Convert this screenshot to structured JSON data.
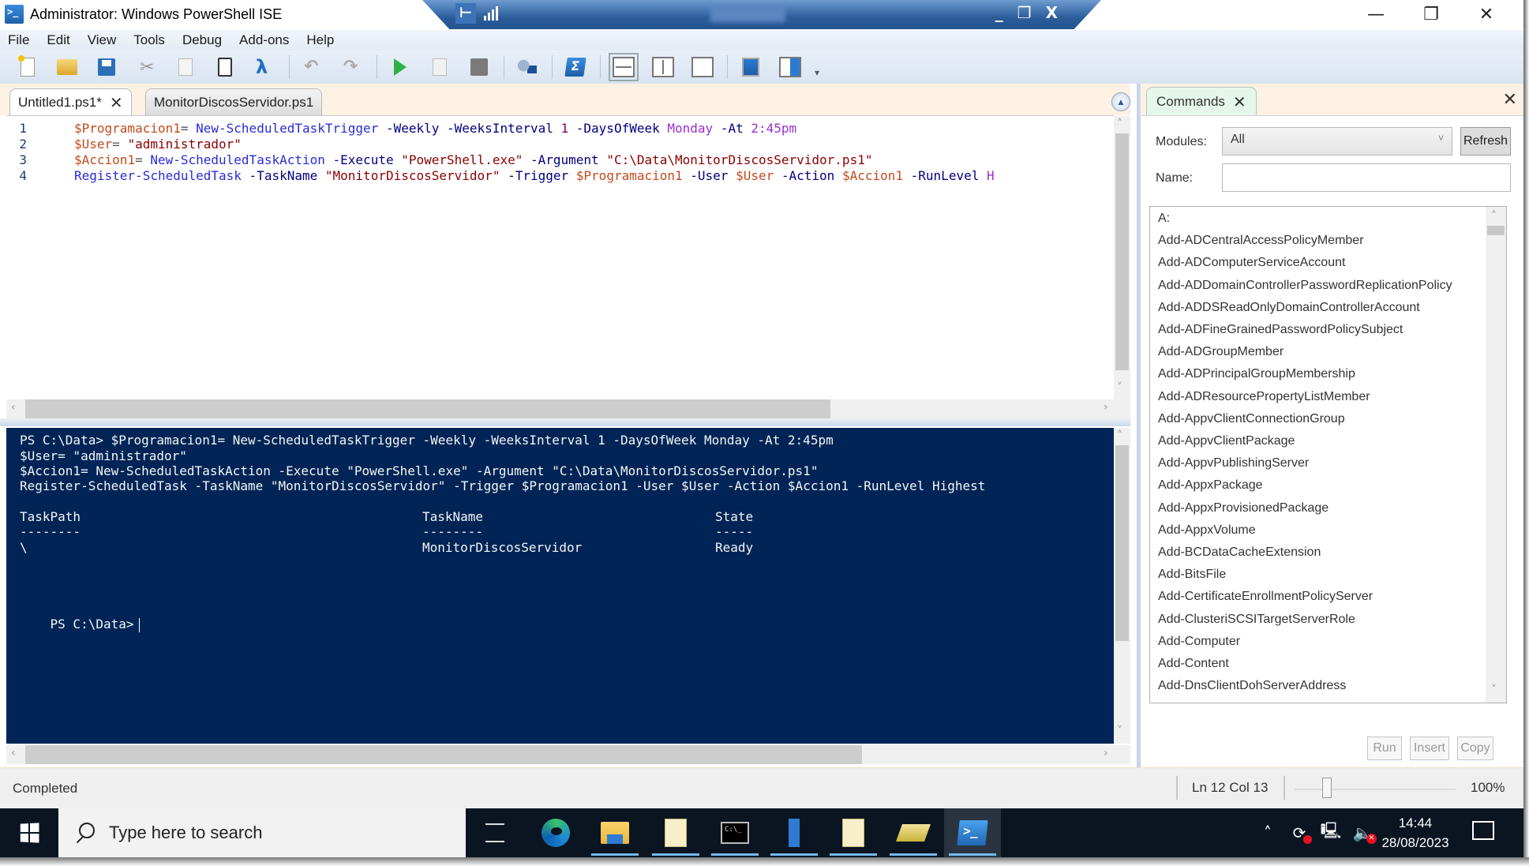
{
  "window": {
    "title": "Administrator: Windows PowerShell ISE",
    "controls": {
      "minimize": "—",
      "restore": "❐",
      "close": "✕"
    }
  },
  "rdp_bar": {
    "pin_icon": "pin-icon",
    "signal_icon": "connection-quality-icon",
    "minimize": "_",
    "restore": "❐",
    "close": "X"
  },
  "menu": [
    "File",
    "Edit",
    "View",
    "Tools",
    "Debug",
    "Add-ons",
    "Help"
  ],
  "toolbar": {
    "buttons": [
      "new-script",
      "open-script",
      "save-script",
      "cut",
      "copy",
      "paste",
      "clear-console",
      "undo",
      "redo",
      "run-script",
      "run-selection",
      "stop-operation",
      "new-remote-powershell-tab",
      "start-powershell-exe",
      "show-script-pane-top",
      "show-script-pane-right",
      "show-script-pane-maximized",
      "show-script-pane",
      "show-command-add-on",
      "more"
    ]
  },
  "script_tabs": [
    {
      "label": "Untitled1.ps1*",
      "active": true,
      "close": "✕"
    },
    {
      "label": "MonitorDiscosServidor.ps1",
      "active": false
    }
  ],
  "editor": {
    "lines": [
      {
        "num": "1",
        "tokens": [
          {
            "t": "$Programacion1",
            "c": "var"
          },
          {
            "t": "= ",
            "c": "op"
          },
          {
            "t": "New-ScheduledTaskTrigger",
            "c": "cmd"
          },
          {
            "t": " -Weekly -WeeksInterval ",
            "c": "param"
          },
          {
            "t": "1",
            "c": "num"
          },
          {
            "t": " -DaysOfWeek ",
            "c": "param"
          },
          {
            "t": "Monday",
            "c": "attr"
          },
          {
            "t": " -At ",
            "c": "param"
          },
          {
            "t": "2:45pm",
            "c": "attr"
          }
        ]
      },
      {
        "num": "2",
        "tokens": [
          {
            "t": "$User",
            "c": "var"
          },
          {
            "t": "= ",
            "c": "op"
          },
          {
            "t": "\"administrador\"",
            "c": "str"
          }
        ]
      },
      {
        "num": "3",
        "tokens": [
          {
            "t": "$Accion1",
            "c": "var"
          },
          {
            "t": "= ",
            "c": "op"
          },
          {
            "t": "New-ScheduledTaskAction",
            "c": "cmd"
          },
          {
            "t": " -Execute ",
            "c": "param"
          },
          {
            "t": "\"PowerShell.exe\"",
            "c": "str"
          },
          {
            "t": " -Argument ",
            "c": "param"
          },
          {
            "t": "\"C:\\Data\\MonitorDiscosServidor.ps1\"",
            "c": "str"
          }
        ]
      },
      {
        "num": "4",
        "tokens": [
          {
            "t": "Register-ScheduledTask",
            "c": "cmd"
          },
          {
            "t": " -TaskName ",
            "c": "param"
          },
          {
            "t": "\"MonitorDiscosServidor\"",
            "c": "str"
          },
          {
            "t": " -Trigger ",
            "c": "param"
          },
          {
            "t": "$Programacion1",
            "c": "var"
          },
          {
            "t": " -User ",
            "c": "param"
          },
          {
            "t": "$User",
            "c": "var"
          },
          {
            "t": " -Action ",
            "c": "param"
          },
          {
            "t": "$Accion1",
            "c": "var"
          },
          {
            "t": " -RunLevel ",
            "c": "param"
          },
          {
            "t": "H",
            "c": "attr"
          }
        ]
      }
    ]
  },
  "console": {
    "lines": [
      "PS C:\\Data> $Programacion1= New-ScheduledTaskTrigger -Weekly -WeeksInterval 1 -DaysOfWeek Monday -At 2:45pm",
      "$User= \"administrador\"",
      "$Accion1= New-ScheduledTaskAction -Execute \"PowerShell.exe\" -Argument \"C:\\Data\\MonitorDiscosServidor.ps1\"",
      "Register-ScheduledTask -TaskName \"MonitorDiscosServidor\" -Trigger $Programacion1 -User $User -Action $Accion1 -RunLevel Highest"
    ],
    "table": {
      "headers": [
        "TaskPath",
        "TaskName",
        "State"
      ],
      "underline": [
        "--------",
        "--------",
        "-----"
      ],
      "rows": [
        [
          "\\",
          "MonitorDiscosServidor",
          "Ready"
        ]
      ]
    },
    "prompt": "PS C:\\Data>"
  },
  "commands_pane": {
    "tab_label": "Commands",
    "tab_close": "✕",
    "pane_close": "✕",
    "modules_label": "Modules:",
    "modules_value": "All",
    "refresh_label": "Refresh",
    "name_label": "Name:",
    "name_value": "",
    "items": [
      "A:",
      "Add-ADCentralAccessPolicyMember",
      "Add-ADComputerServiceAccount",
      "Add-ADDomainControllerPasswordReplicationPolicy",
      "Add-ADDSReadOnlyDomainControllerAccount",
      "Add-ADFineGrainedPasswordPolicySubject",
      "Add-ADGroupMember",
      "Add-ADPrincipalGroupMembership",
      "Add-ADResourcePropertyListMember",
      "Add-AppvClientConnectionGroup",
      "Add-AppvClientPackage",
      "Add-AppvPublishingServer",
      "Add-AppxPackage",
      "Add-AppxProvisionedPackage",
      "Add-AppxVolume",
      "Add-BCDataCacheExtension",
      "Add-BitsFile",
      "Add-CertificateEnrollmentPolicyServer",
      "Add-ClusteriSCSITargetServerRole",
      "Add-Computer",
      "Add-Content",
      "Add-DnsClientDohServerAddress"
    ],
    "run_label": "Run",
    "insert_label": "Insert",
    "copy_label": "Copy"
  },
  "status": {
    "text": "Completed",
    "position": "Ln 12  Col 13",
    "zoom": "100%",
    "zoom_fraction": 0.2
  },
  "taskbar": {
    "search_placeholder": "Type here to search",
    "apps": [
      "task-view",
      "microsoft-edge",
      "file-explorer",
      "script-document",
      "command-prompt",
      "server-manager",
      "notepad-document",
      "archive-tool",
      "powershell-ise"
    ],
    "time": "14:44",
    "date": "28/08/2023"
  },
  "colors": {
    "console_bg": "#012456",
    "variable": "#c34a1c",
    "cmdlet": "#2b2bd9",
    "parameter": "#000080",
    "string": "#8b0000",
    "number": "#800080",
    "pane_bg": "#fdf1e4"
  }
}
